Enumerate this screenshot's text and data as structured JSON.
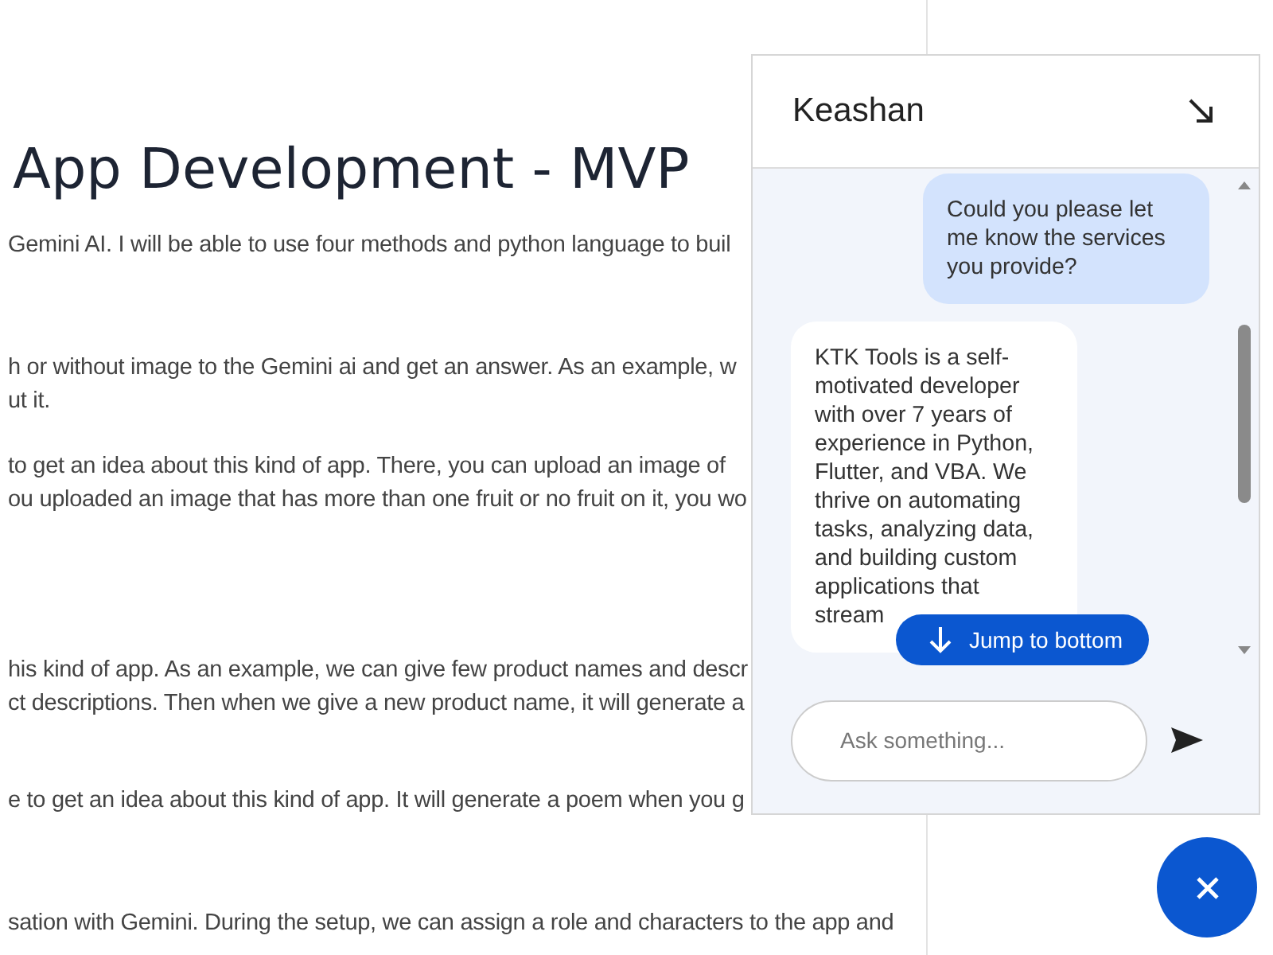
{
  "page": {
    "title": "App Development - MVP",
    "paragraphs": [
      [
        "Gemini AI. I will be able to use four methods and python language to buil"
      ],
      [
        "h or without image to the Gemini ai and get an answer. As an example, w",
        "ut it."
      ],
      [
        "to get an idea about this kind of app. There, you can upload an image of",
        "ou uploaded an image that has more than one fruit or no fruit on it, you wo"
      ],
      [
        "his kind of app. As an example, we can give few product names and descr",
        "ct descriptions. Then when we give a new product name, it will generate a"
      ],
      [
        "e to get an idea about this kind of app. It will generate a poem when you g"
      ],
      [
        "sation with Gemini. During the setup, we can assign a role and characters to the app and"
      ]
    ]
  },
  "chat": {
    "title": "Keashan",
    "messages": [
      {
        "kind": "question",
        "text": "Could you please let me know the services you provide?"
      },
      {
        "kind": "answer",
        "text": "KTK Tools is a self-motivated developer with over 7 years of experience in Python, Flutter, and VBA. We thrive on automating tasks, analyzing data, and building custom applications that stream"
      }
    ],
    "jump_button": "Jump to bottom",
    "input": {
      "placeholder": "Ask something..."
    }
  }
}
